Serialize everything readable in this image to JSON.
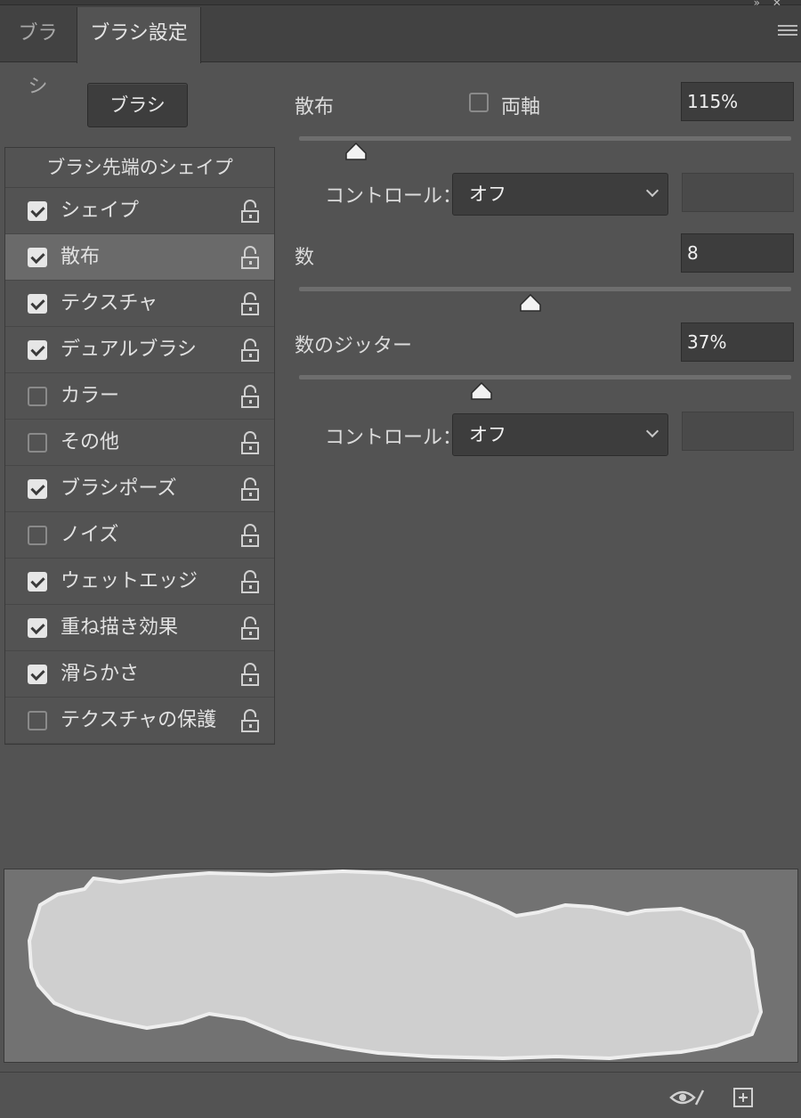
{
  "tabs": [
    {
      "label": "ブラシ",
      "active": false
    },
    {
      "label": "ブラシ設定",
      "active": true
    }
  ],
  "brush_button_label": "ブラシ",
  "list": {
    "header": "ブラシ先端のシェイプ",
    "items": [
      {
        "label": "シェイプ",
        "checked": true,
        "selected": false
      },
      {
        "label": "散布",
        "checked": true,
        "selected": true
      },
      {
        "label": "テクスチャ",
        "checked": true,
        "selected": false
      },
      {
        "label": "デュアルブラシ",
        "checked": true,
        "selected": false
      },
      {
        "label": "カラー",
        "checked": false,
        "selected": false
      },
      {
        "label": "その他",
        "checked": false,
        "selected": false
      },
      {
        "label": "ブラシポーズ",
        "checked": true,
        "selected": false
      },
      {
        "label": "ノイズ",
        "checked": false,
        "selected": false
      },
      {
        "label": "ウェットエッジ",
        "checked": true,
        "selected": false
      },
      {
        "label": "重ね描き効果",
        "checked": true,
        "selected": false
      },
      {
        "label": "滑らかさ",
        "checked": true,
        "selected": false
      },
      {
        "label": "テクスチャの保護",
        "checked": false,
        "selected": false
      }
    ]
  },
  "scatter": {
    "label": "散布",
    "both_axes_label": "両軸",
    "both_axes_checked": false,
    "value": "115%",
    "slider_fraction": 0.115,
    "control_label": "コントロール：",
    "control_value": "オフ"
  },
  "count": {
    "label": "数",
    "value": "8",
    "slider_fraction": 0.47
  },
  "count_jitter": {
    "label": "数のジッター",
    "value": "37%",
    "slider_fraction": 0.37,
    "control_label": "コントロール：",
    "control_value": "オフ"
  },
  "icons": {
    "panel_menu": "hamburger-menu-icon",
    "visibility": "eye-brush-icon",
    "new": "new-brush-icon",
    "lock": "lock-icon"
  },
  "colors": {
    "panel_bg": "#535353",
    "tabbar_bg": "#424242",
    "selected_row": "#6a6a6a",
    "field_bg": "#3d3d3d",
    "preview_bg": "#727272",
    "stroke": "#d4d4d4"
  }
}
